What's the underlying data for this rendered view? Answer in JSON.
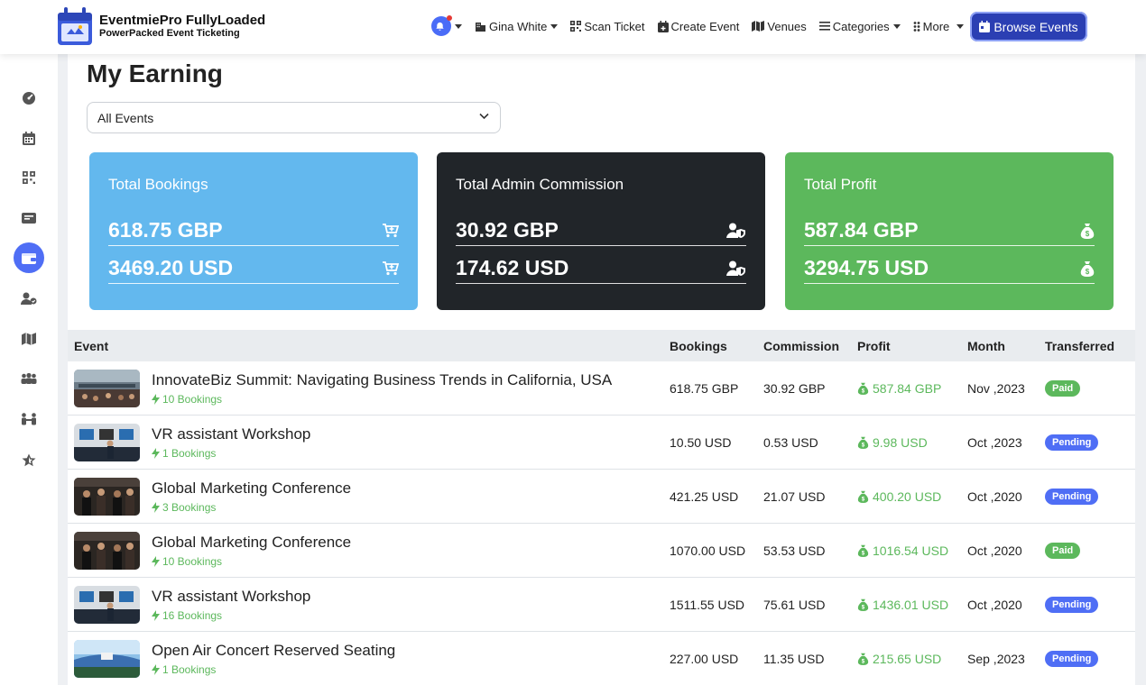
{
  "brand": {
    "title": "EventmiePro FullyLoaded",
    "subtitle": "PowerPacked Event Ticketing"
  },
  "nav": {
    "notifications_icon": "bell-icon",
    "user": "Gina White",
    "scan_ticket": "Scan Ticket",
    "create_event": "Create Event",
    "venues": "Venues",
    "categories": "Categories",
    "more": "More",
    "browse_events": "Browse Events"
  },
  "sidebar": {
    "items": [
      {
        "icon": "dashboard-icon",
        "active": false
      },
      {
        "icon": "calendar-icon",
        "active": false
      },
      {
        "icon": "qrcode-icon",
        "active": false
      },
      {
        "icon": "ticket-icon",
        "active": false
      },
      {
        "icon": "wallet-icon",
        "active": true
      },
      {
        "icon": "users-icon",
        "active": false
      },
      {
        "icon": "map-icon",
        "active": false
      },
      {
        "icon": "people-icon",
        "active": false
      },
      {
        "icon": "handshake-icon",
        "active": false
      },
      {
        "icon": "star-icon",
        "active": false
      }
    ]
  },
  "page": {
    "title": "My Earning",
    "event_filter": "All Events"
  },
  "stats": {
    "bookings": {
      "title": "Total Bookings",
      "v1": "618.75 GBP",
      "v2": "3469.20 USD",
      "color": "#63b8ee"
    },
    "commission": {
      "title": "Total Admin Commission",
      "v1": "30.92 GBP",
      "v2": "174.62 USD",
      "color": "#212529"
    },
    "profit": {
      "title": "Total Profit",
      "v1": "587.84 GBP",
      "v2": "3294.75 USD",
      "color": "#5cb85c"
    }
  },
  "table": {
    "headers": {
      "event": "Event",
      "bookings": "Bookings",
      "commission": "Commission",
      "profit": "Profit",
      "month": "Month",
      "transferred": "Transferred"
    },
    "rows": [
      {
        "title": "InnovateBiz Summit: Navigating Business Trends in California, USA",
        "count": "10 Bookings",
        "bookings": "618.75 GBP",
        "commission": "30.92 GBP",
        "profit": "587.84 GBP",
        "month": "Nov ,2023",
        "status": "Paid"
      },
      {
        "title": "VR assistant Workshop",
        "count": "1 Bookings",
        "bookings": "10.50 USD",
        "commission": "0.53 USD",
        "profit": "9.98 USD",
        "month": "Oct ,2023",
        "status": "Pending"
      },
      {
        "title": "Global Marketing Conference",
        "count": "3 Bookings",
        "bookings": "421.25 USD",
        "commission": "21.07 USD",
        "profit": "400.20 USD",
        "month": "Oct ,2020",
        "status": "Pending"
      },
      {
        "title": "Global Marketing Conference",
        "count": "10 Bookings",
        "bookings": "1070.00 USD",
        "commission": "53.53 USD",
        "profit": "1016.54 USD",
        "month": "Oct ,2020",
        "status": "Paid"
      },
      {
        "title": "VR assistant Workshop",
        "count": "16 Bookings",
        "bookings": "1511.55 USD",
        "commission": "75.61 USD",
        "profit": "1436.01 USD",
        "month": "Oct ,2020",
        "status": "Pending"
      },
      {
        "title": "Open Air Concert Reserved Seating",
        "count": "1 Bookings",
        "bookings": "227.00 USD",
        "commission": "11.35 USD",
        "profit": "215.65 USD",
        "month": "Sep ,2023",
        "status": "Pending"
      }
    ]
  }
}
